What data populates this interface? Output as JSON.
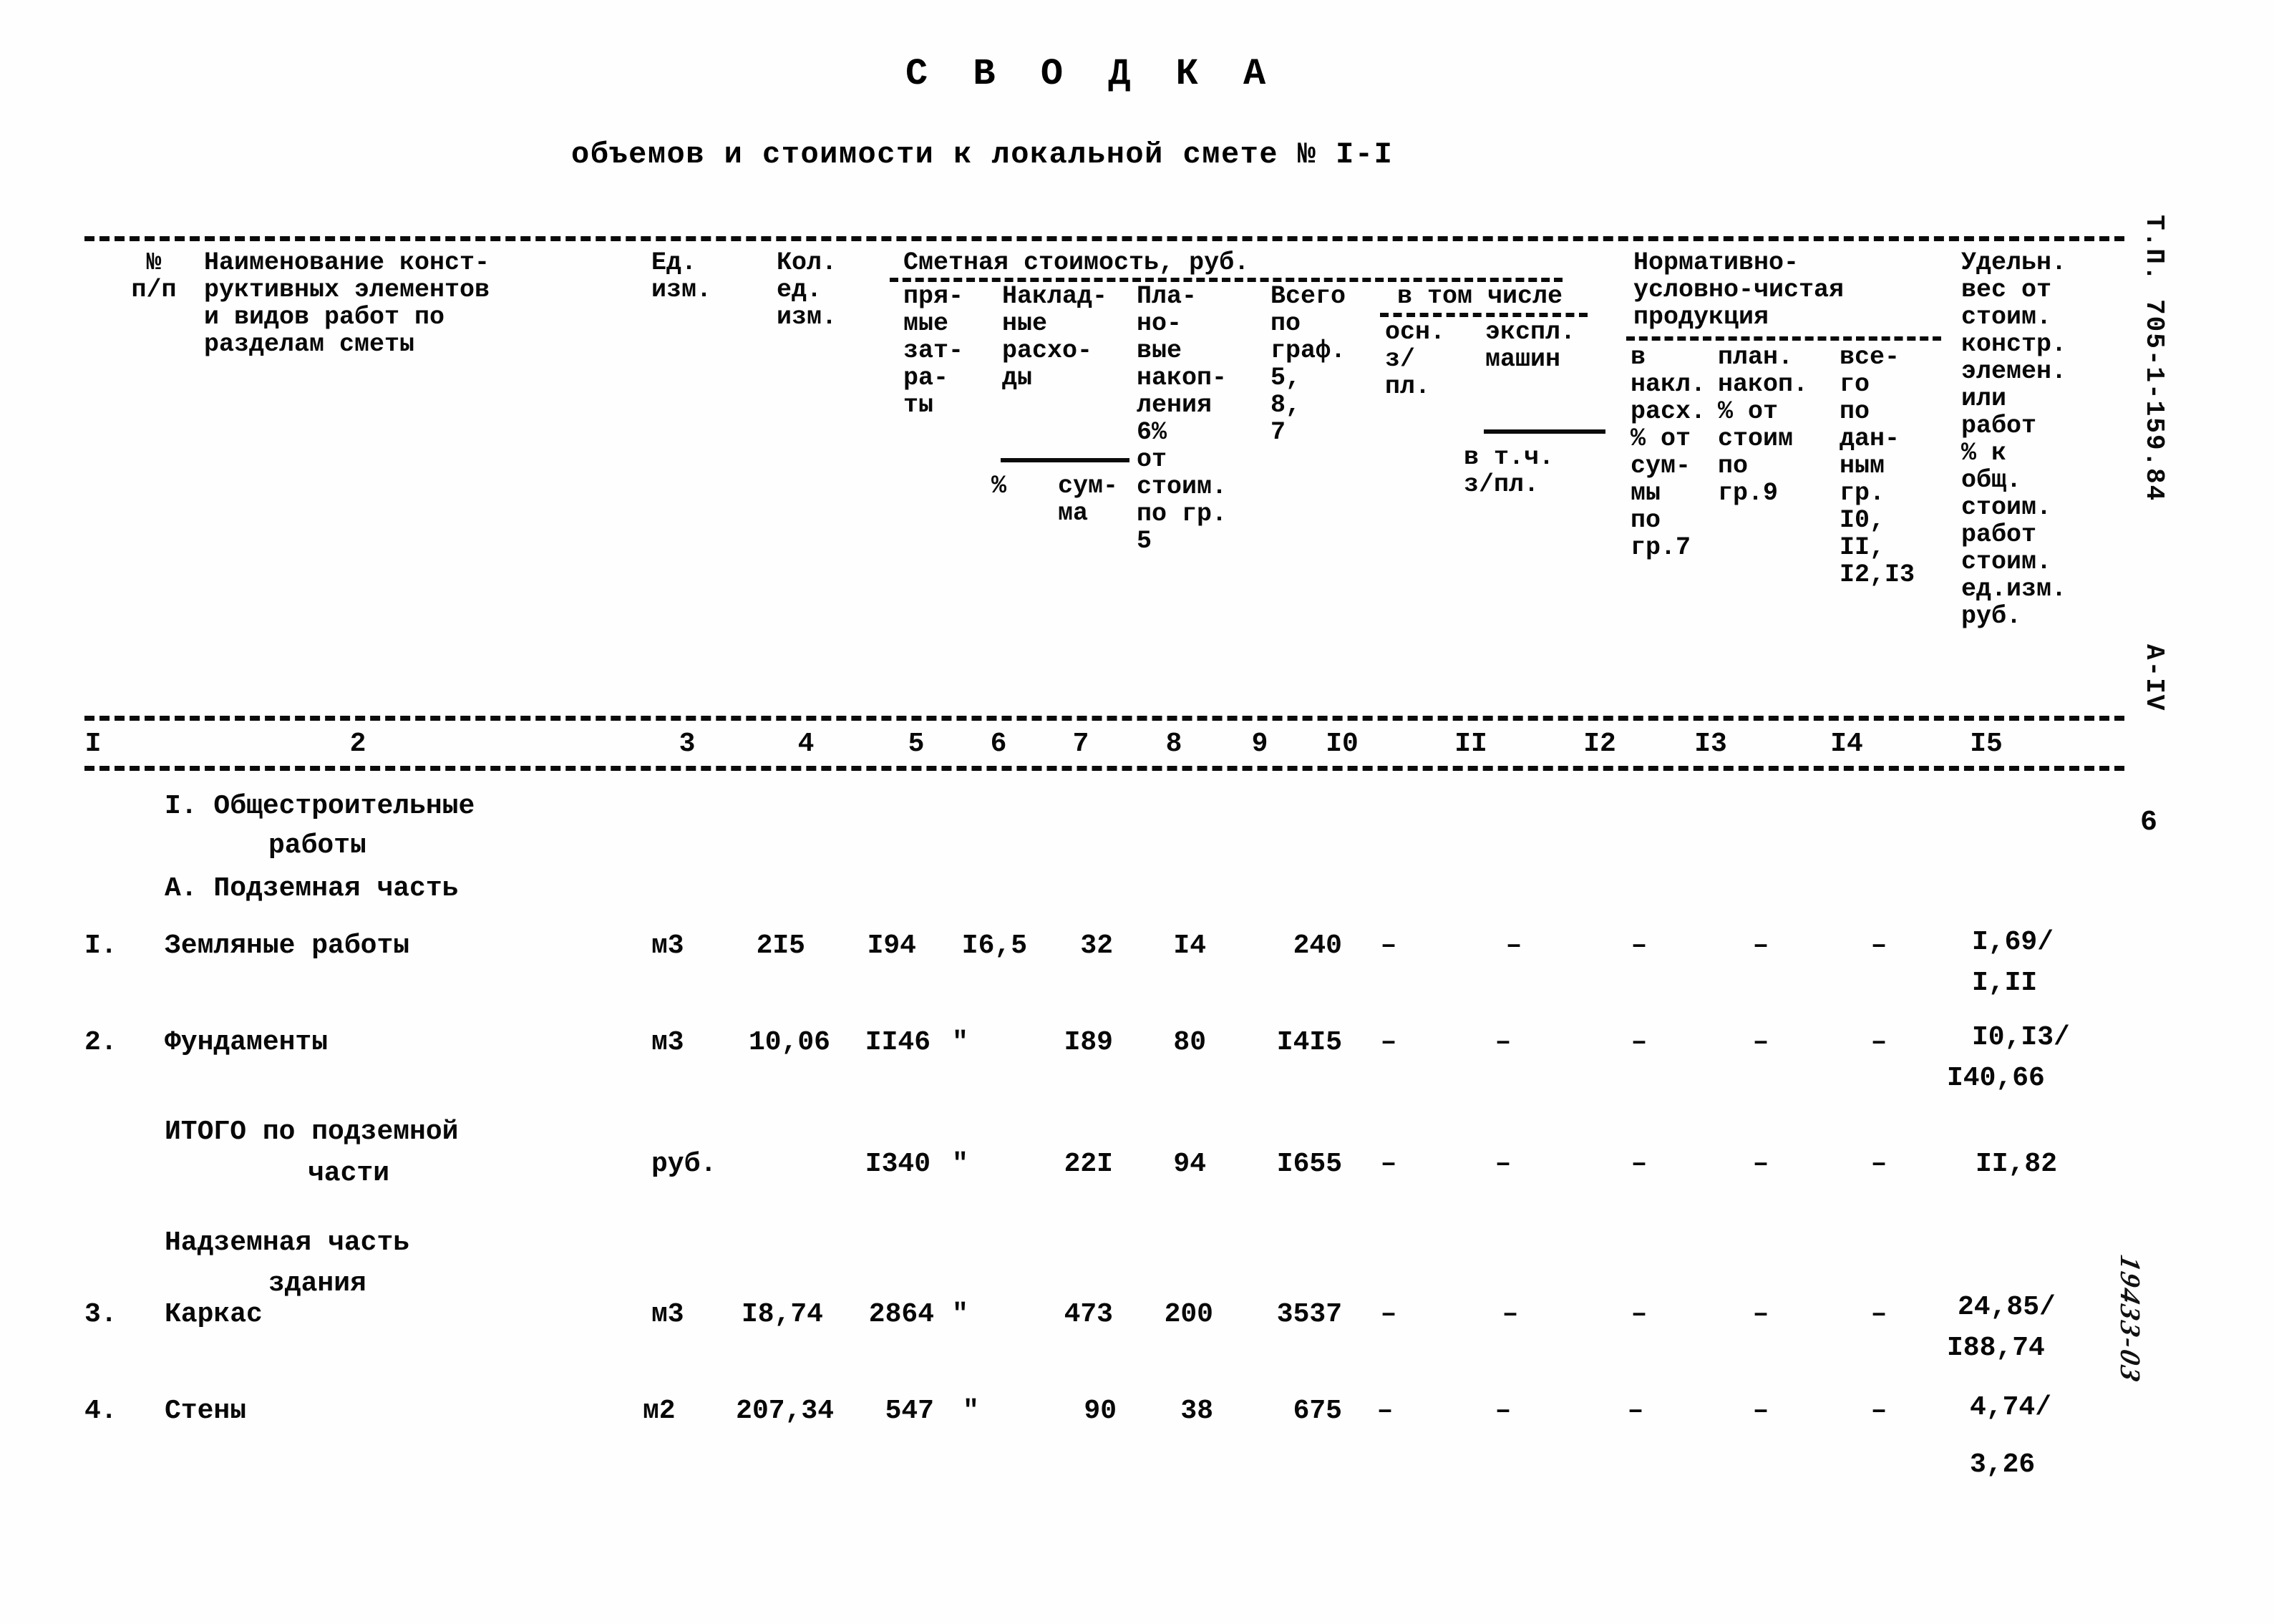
{
  "document": {
    "title": "С В О Д К А",
    "subtitle": "объемов и стоимости к локальной смете № I-I",
    "margin_code": "Т.П. 705-1-159.84",
    "margin_series": "А-IV",
    "page_number": "6",
    "handwritten_note": "19433-03"
  },
  "table": {
    "header": {
      "col1": "№\nп/п",
      "col2": "Наименование конст-\nруктивных элементов\nи видов работ по\nразделам сметы",
      "col3": "Ед.\nизм.",
      "col4": "Кол.\nед.\nизм.",
      "group_smeta": "Сметная стоимость, руб.",
      "group_vtomchisle": "в том числе",
      "group_nucp": "Нормативно-\nусловно-чистая\nпродукция",
      "col5": "пря-\nмые\nзат-\nра-\nты",
      "col6_7_label": "Наклад-\nные\nрасхо-\nды",
      "col6": "%",
      "col7": "сум-\nма",
      "col8": "Пла-\nно-\nвые\nнакоп-\nления\n6%\nот\nстоим.\nпо гр.\n5",
      "col9": "Всего\nпо\nграф.\n5,\n8,\n7",
      "col10": "осн.\nз/\nпл.",
      "col11_label": "экспл.\nмашин",
      "col11": "в т.ч.\nз/пл.",
      "col12": "в\nнакл.\nрасх.\n% от\nсум-\nмы\nпо\nгр.7",
      "col13": "план.\nнакоп.\n% от\nстоим\nпо\nгр.9",
      "col14": "все-\nго\nпо\nдан-\nным\nгр.\nI0,\nII,\nI2,I3",
      "col15": "Удельн.\nвес от\nстоим.\nконстр.\nэлемен.\nили\nработ\n% к\nобщ.\nстоим.\nработ\nстоим.\nед.изм.\nруб."
    },
    "column_numbers": [
      "I",
      "2",
      "3",
      "4",
      "5",
      "6",
      "7",
      "8",
      "9",
      "I0",
      "II",
      "I2",
      "I3",
      "I4",
      "I5"
    ],
    "rows": [
      {
        "kind": "section",
        "lines": [
          "I. Общестроительные",
          "работы",
          "А. Подземная часть"
        ]
      },
      {
        "kind": "data",
        "no": "I.",
        "name": "Земляные работы",
        "unit": "м3",
        "qty": "2I5",
        "direct": "I94",
        "oh_pct": "I6,5",
        "oh_sum": "32",
        "plan_accum": "I4",
        "total": "240",
        "osn_zp": "–",
        "mach": "–",
        "mach_zp": "–",
        "nucp_nakl": "–",
        "nucp_plan": "–",
        "nucp_total": "–",
        "share": [
          "I,69/",
          "I,II"
        ]
      },
      {
        "kind": "data",
        "no": "2.",
        "name": "Фундаменты",
        "unit": "м3",
        "qty": "10,06",
        "direct": "II46",
        "oh_pct": "\"",
        "oh_sum": "I89",
        "plan_accum": "80",
        "total": "I4I5",
        "osn_zp": "–",
        "mach": "–",
        "mach_zp": "–",
        "nucp_nakl": "–",
        "nucp_plan": "–",
        "nucp_total": "–",
        "share": [
          "I0,I3/",
          "I40,66"
        ]
      },
      {
        "kind": "total",
        "no": "",
        "name_lines": [
          "ИТОГО по подземной",
          "части"
        ],
        "unit": "руб.",
        "qty": "",
        "direct": "I340",
        "oh_pct": "\"",
        "oh_sum": "22I",
        "plan_accum": "94",
        "total": "I655",
        "osn_zp": "–",
        "mach": "–",
        "mach_zp": "–",
        "nucp_nakl": "–",
        "nucp_plan": "–",
        "nucp_total": "–",
        "share": [
          "II,82"
        ]
      },
      {
        "kind": "section",
        "lines": [
          "Надземная часть",
          "здания"
        ]
      },
      {
        "kind": "data",
        "no": "3.",
        "name": "Каркас",
        "unit": "м3",
        "qty": "I8,74",
        "direct": "2864",
        "oh_pct": "\"",
        "oh_sum": "473",
        "plan_accum": "200",
        "total": "3537",
        "osn_zp": "–",
        "mach": "–",
        "mach_zp": "–",
        "nucp_nakl": "–",
        "nucp_plan": "–",
        "nucp_total": "–",
        "share": [
          "24,85/",
          "I88,74"
        ]
      },
      {
        "kind": "data",
        "no": "4.",
        "name": "Стены",
        "unit": "м2",
        "qty": "207,34",
        "direct": "547",
        "oh_pct": "\"",
        "oh_sum": "90",
        "plan_accum": "38",
        "total": "675",
        "osn_zp": "–",
        "mach": "–",
        "mach_zp": "–",
        "nucp_nakl": "–",
        "nucp_plan": "–",
        "nucp_total": "–",
        "share": [
          "4,74/",
          "3,26"
        ]
      }
    ]
  }
}
